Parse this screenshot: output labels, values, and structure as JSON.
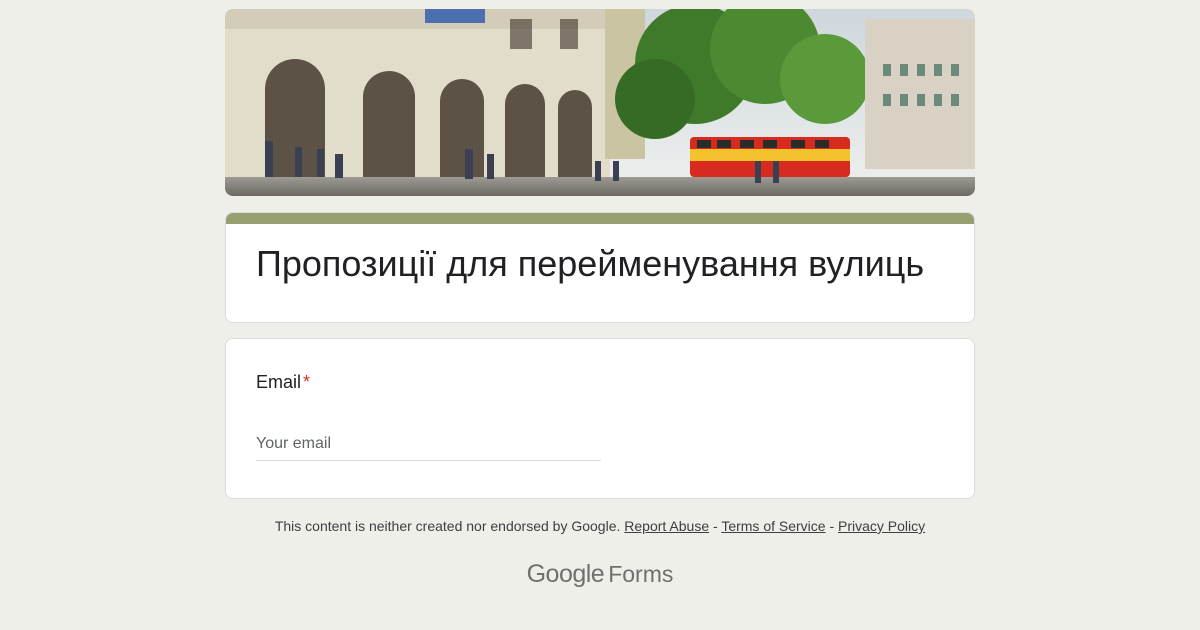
{
  "form": {
    "title": "Пропозиції для перейменування вулиць",
    "accent_color": "#98a072",
    "header_image": "city-square-photo"
  },
  "question": {
    "label": "Email",
    "required_mark": "*",
    "placeholder": "Your email",
    "value": ""
  },
  "footer": {
    "disclaimer": "This content is neither created nor endorsed by Google.",
    "separator": " - ",
    "links": {
      "report_abuse": "Report Abuse",
      "terms": "Terms of Service",
      "privacy": "Privacy Policy"
    },
    "brand": "Google",
    "product": "Forms"
  }
}
